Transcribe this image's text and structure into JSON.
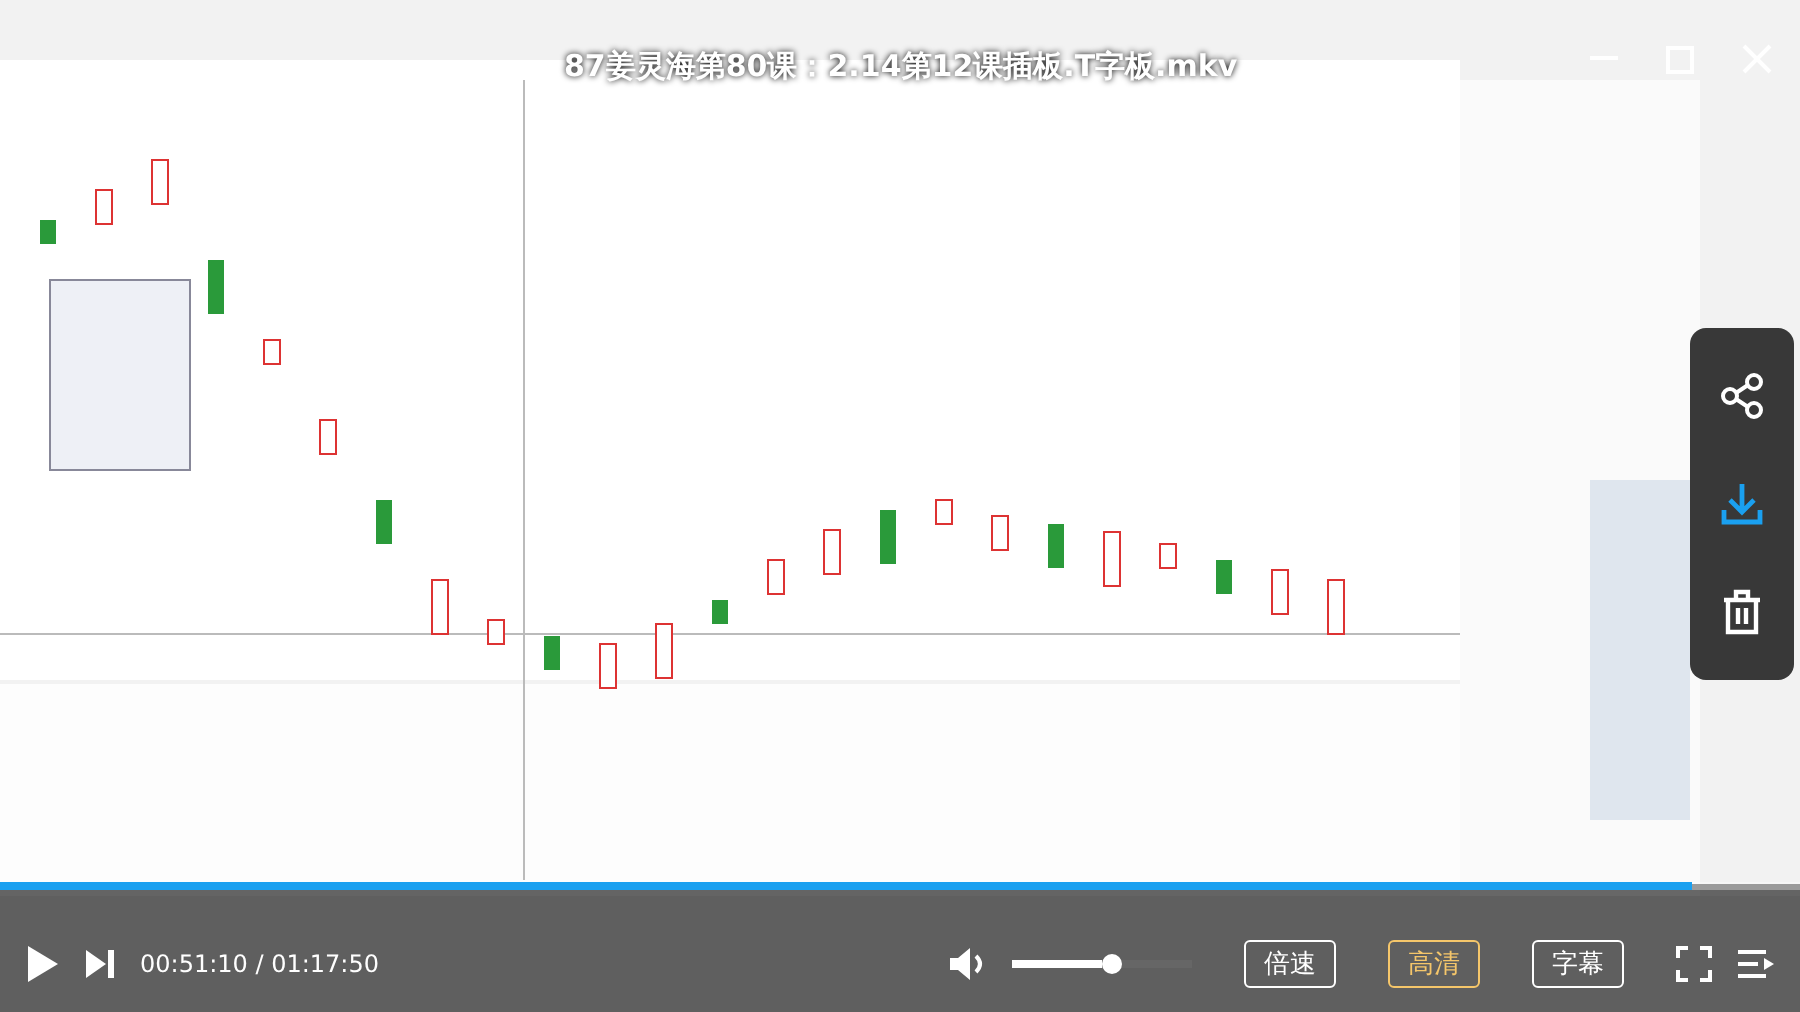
{
  "title": "87姜灵海第80课：2.14第12课插板.T字板.mkv",
  "side_actions": [
    {
      "kind": "share"
    },
    {
      "kind": "download"
    },
    {
      "kind": "delete"
    }
  ],
  "progress": {
    "level": 0.94
  },
  "time": "00:51:10 / 01:17:50",
  "volume": {
    "level": 0.5
  },
  "buttons": [
    {
      "label": "倍速",
      "selected": false
    },
    {
      "label": "高清",
      "selected": true
    },
    {
      "label": "字幕",
      "selected": false
    }
  ]
}
